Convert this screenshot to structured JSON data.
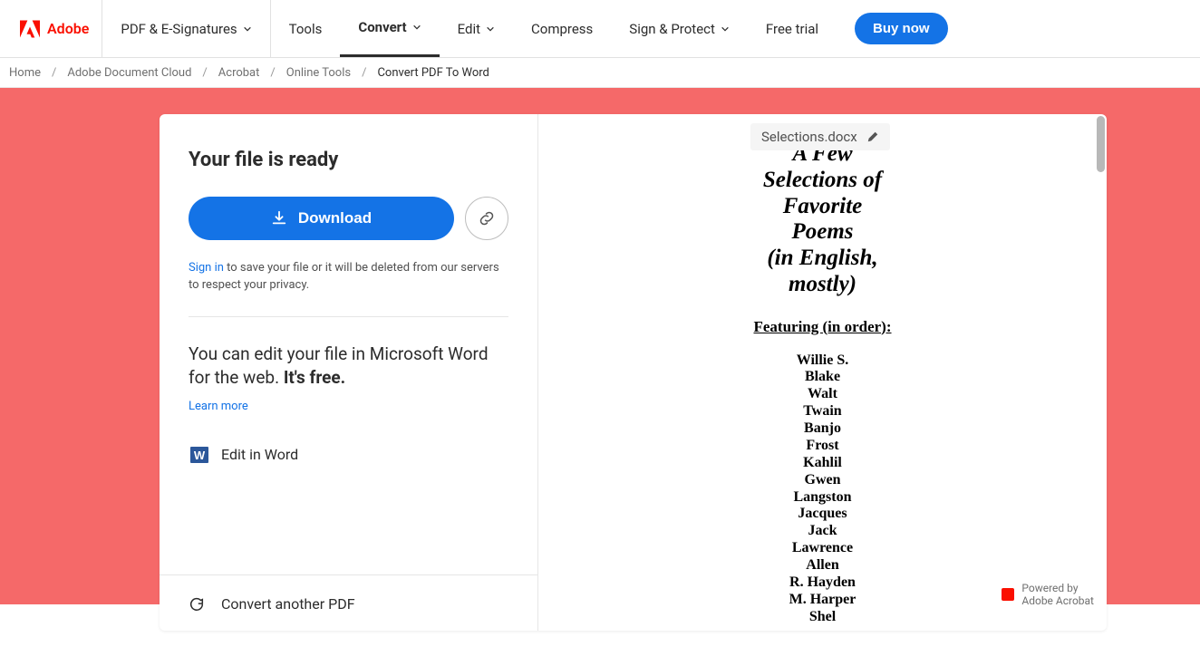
{
  "brand": {
    "name": "Adobe"
  },
  "nav": {
    "pdf_esign": "PDF & E-Signatures",
    "tools": "Tools",
    "convert": "Convert",
    "edit": "Edit",
    "compress": "Compress",
    "sign_protect": "Sign & Protect",
    "free_trial": "Free trial",
    "buy_now": "Buy now"
  },
  "breadcrumb": {
    "home": "Home",
    "doc_cloud": "Adobe Document Cloud",
    "acrobat": "Acrobat",
    "online_tools": "Online Tools",
    "current": "Convert PDF To Word"
  },
  "panel": {
    "ready_title": "Your file is ready",
    "download": "Download",
    "signin_link": "Sign in",
    "signin_rest": " to save your file or it will be deleted from our servers to respect your privacy.",
    "edit_line1": "You can edit your file in Microsoft Word for the web. ",
    "edit_free": "It's free.",
    "learn_more": "Learn more",
    "edit_in_word": "Edit in Word",
    "convert_another": "Convert another PDF"
  },
  "file": {
    "name": "Selections.docx"
  },
  "preview": {
    "title_lines": "A Few\nSelections of\nFavorite\nPoems\n(in English,\nmostly)",
    "featuring": "Featuring (in order):",
    "poets": [
      "Willie S.",
      "Blake",
      "Walt",
      "Twain",
      "Banjo",
      "Frost",
      "Kahlil",
      "Gwen",
      "Langston",
      "Jacques",
      "Jack",
      "Lawrence",
      "Allen",
      "R. Hayden",
      "M. Harper",
      "Shel"
    ]
  },
  "powered": {
    "line1": "Powered by",
    "line2": "Adobe Acrobat"
  }
}
